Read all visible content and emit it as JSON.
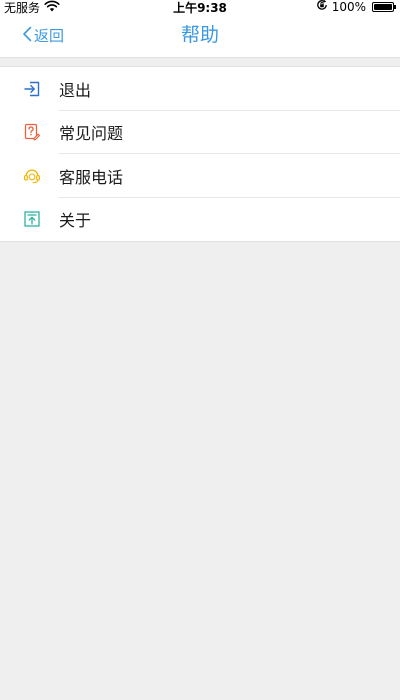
{
  "status_bar": {
    "carrier": "无服务",
    "time": "上午9:38",
    "battery": "100%",
    "icons": [
      "wifi-icon",
      "orientation-lock-icon",
      "battery-icon"
    ]
  },
  "nav": {
    "back_label": "返回",
    "title": "帮助"
  },
  "menu": {
    "items": [
      {
        "label": "退出",
        "icon": "logout-icon",
        "color": "#2c6fd1"
      },
      {
        "label": "常见问题",
        "icon": "faq-icon",
        "color": "#e8603c"
      },
      {
        "label": "客服电话",
        "icon": "headset-icon",
        "color": "#f0b400"
      },
      {
        "label": "关于",
        "icon": "about-icon",
        "color": "#2bb3a3"
      }
    ]
  },
  "colors": {
    "accent": "#3a98e0",
    "background": "#efefef",
    "list_background": "#ffffff"
  }
}
